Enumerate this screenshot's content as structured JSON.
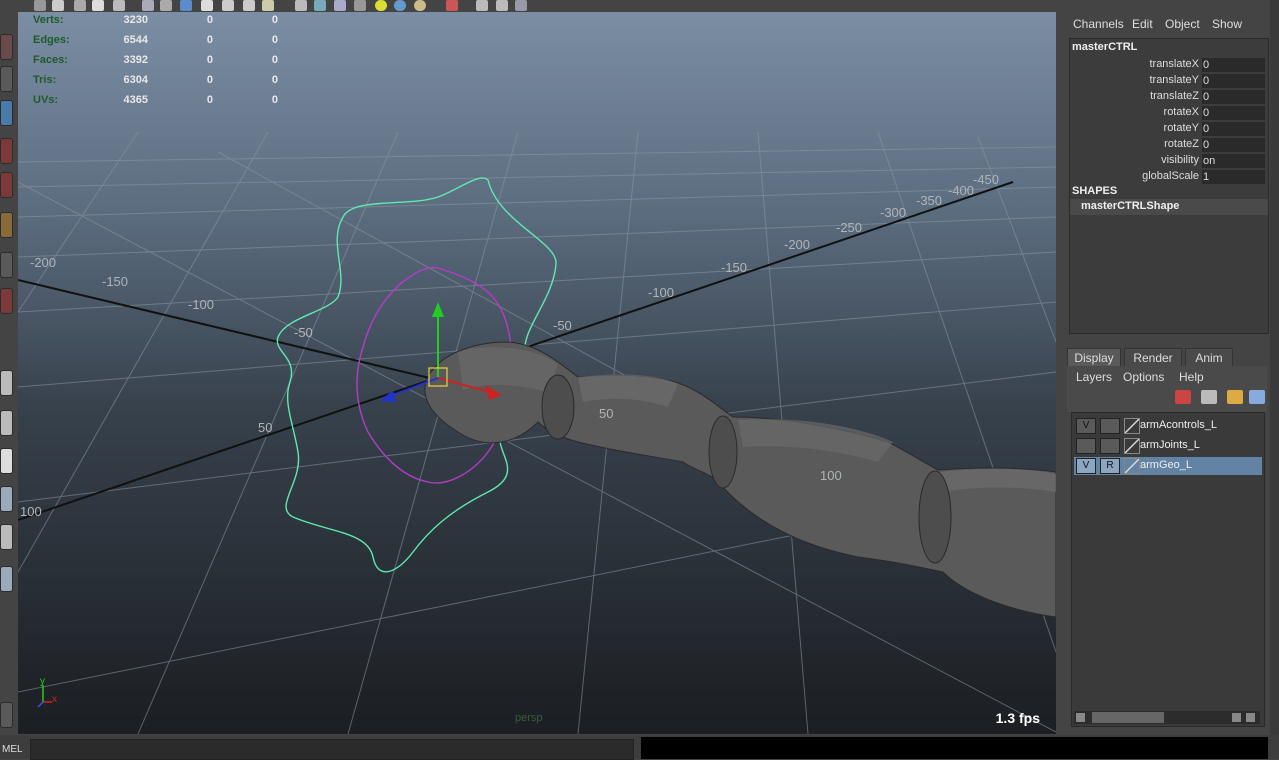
{
  "hud": {
    "rows": [
      {
        "label": "Verts:",
        "a": "3230",
        "b": "0",
        "c": "0"
      },
      {
        "label": "Edges:",
        "a": "6544",
        "b": "0",
        "c": "0"
      },
      {
        "label": "Faces:",
        "a": "3392",
        "b": "0",
        "c": "0"
      },
      {
        "label": "Tris:",
        "a": "6304",
        "b": "0",
        "c": "0"
      },
      {
        "label": "UVs:",
        "a": "4365",
        "b": "0",
        "c": "0"
      }
    ]
  },
  "viewport": {
    "fps": "1.3 fps",
    "camera": "persp",
    "ticks_near": [
      "-200",
      "-150",
      "-100",
      "-50",
      "50",
      "100"
    ],
    "ticks_far": [
      "-450",
      "-400",
      "-350",
      "-300",
      "-250",
      "-200",
      "-150",
      "-100",
      "-50"
    ],
    "ticks_arm": [
      "50",
      "100"
    ],
    "axis_x": "x",
    "axis_y": "y"
  },
  "channel_box": {
    "menu": [
      "Channels",
      "Edit",
      "Object",
      "Show"
    ],
    "object_name": "masterCTRL",
    "attributes": [
      {
        "name": "translateX",
        "value": "0"
      },
      {
        "name": "translateY",
        "value": "0"
      },
      {
        "name": "translateZ",
        "value": "0"
      },
      {
        "name": "rotateX",
        "value": "0"
      },
      {
        "name": "rotateY",
        "value": "0"
      },
      {
        "name": "rotateZ",
        "value": "0"
      },
      {
        "name": "visibility",
        "value": "on"
      },
      {
        "name": "globalScale",
        "value": "1"
      }
    ],
    "shapes_header": "SHAPES",
    "shape_name": "masterCTRLShape"
  },
  "layer_editor": {
    "tabs": [
      "Display",
      "Render",
      "Anim"
    ],
    "menu": [
      "Layers",
      "Options",
      "Help"
    ],
    "layers": [
      {
        "v": "V",
        "p": "",
        "name": "armAcontrols_L",
        "color": "#3c3c3c",
        "selected": false
      },
      {
        "v": "",
        "p": "",
        "name": "armJoints_L",
        "color": "#3c3c3c",
        "selected": false
      },
      {
        "v": "V",
        "p": "R",
        "name": "armGeo_L",
        "color": "#3c3c3c",
        "selected": true
      }
    ]
  },
  "command_line": {
    "label": "MEL"
  },
  "colors": {
    "nurbs_outer": "#5fe8b0",
    "nurbs_inner": "#b43cc8",
    "selected_layer": "#6283a4"
  }
}
